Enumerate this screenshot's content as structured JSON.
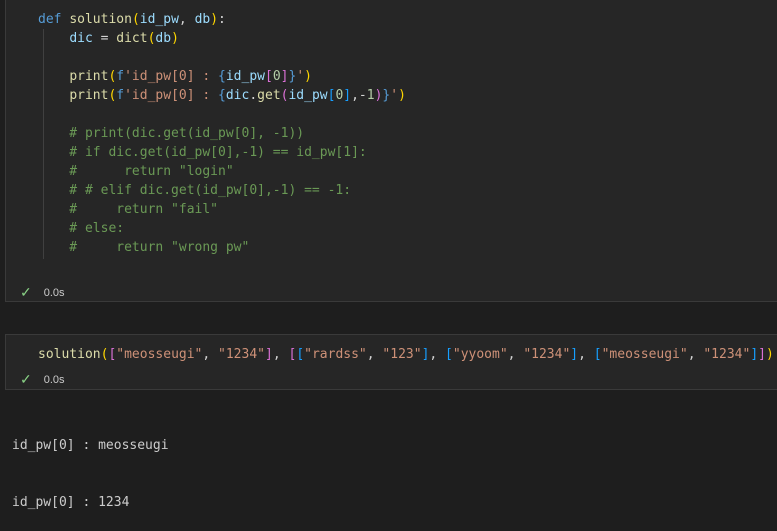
{
  "cell1": {
    "lines": [
      "def solution(id_pw, db):",
      "    dic = dict(db)",
      "",
      "    print(f'id_pw[0] : {id_pw[0]}')",
      "    print(f'id_pw[0] : {dic.get(id_pw[0],-1)}')",
      "",
      "    # print(dic.get(id_pw[0], -1))",
      "    # if dic.get(id_pw[0],-1) == id_pw[1]:",
      "    #      return \"login\"",
      "    # # elif dic.get(id_pw[0],-1) == -1:",
      "    #     return \"fail\"",
      "    # else:",
      "    #     return \"wrong pw\""
    ],
    "status": "0.0s"
  },
  "cell2": {
    "lines": [
      "solution([\"meosseugi\", \"1234\"], [[\"rardss\", \"123\"], [\"yyoom\", \"1234\"], [\"meosseugi\", \"1234\"]])"
    ],
    "status": "0.0s"
  },
  "output": {
    "lines": [
      "id_pw[0] : meosseugi",
      "id_pw[0] : 1234"
    ]
  },
  "icons": {
    "status_check": "check-icon"
  },
  "colors": {
    "success": "#89d185",
    "keyword": "#569cd6",
    "comment": "#6a9955"
  }
}
